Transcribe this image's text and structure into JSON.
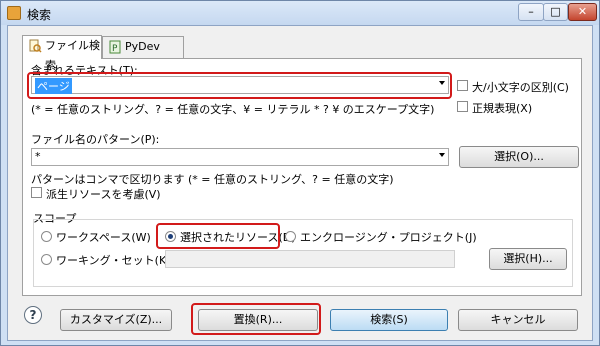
{
  "window": {
    "title": "検索",
    "min": "–",
    "max": "□",
    "close": "✕"
  },
  "tabs": [
    {
      "label": "ファイル検索",
      "icon": "file-search-icon"
    },
    {
      "label": "PyDev Search",
      "icon": "pydev-icon"
    }
  ],
  "text_search": {
    "label": "含まれるテキスト(T):",
    "value": "ページ",
    "hint": "(* = 任意のストリング、? = 任意の文字、¥ = リテラル * ? ¥ のエスケープ文字)",
    "case_sensitive_label": "大/小文字の区別(C)",
    "regex_label": "正規表現(X)"
  },
  "file_pattern": {
    "label": "ファイル名のパターン(P):",
    "value": "*",
    "hint": "パターンはコンマで区切ります (* = 任意のストリング、? = 任意の文字)",
    "choose_button": "選択(O)...",
    "derived_label": "派生リソースを考慮(V)"
  },
  "scope": {
    "title": "スコープ",
    "workspace_label": "ワークスペース(W)",
    "selected_label": "選択されたリソース(D)",
    "enclosing_label": "エンクロージング・プロジェクト(J)",
    "working_set_label": "ワーキング・セット(K):",
    "working_set_value": "",
    "choose_button": "選択(H)...",
    "selected_option": "selected"
  },
  "footer": {
    "help": "?",
    "customize": "カスタマイズ(Z)...",
    "replace": "置換(R)...",
    "search": "検索(S)",
    "cancel": "キャンセル"
  }
}
